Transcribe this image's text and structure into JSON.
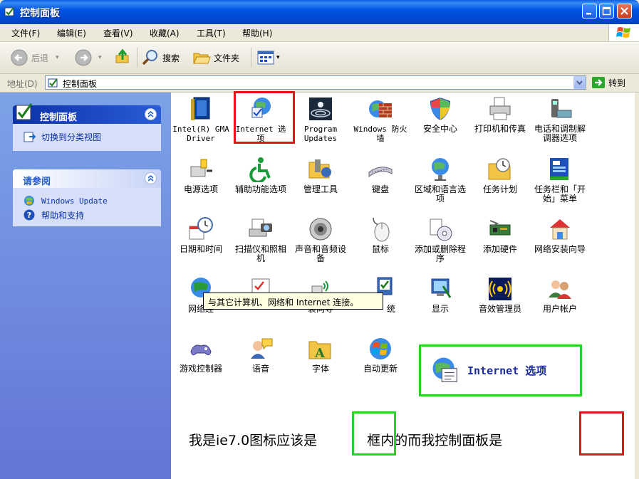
{
  "window": {
    "title": "控制面板"
  },
  "menu": [
    "文件(F)",
    "编辑(E)",
    "查看(V)",
    "收藏(A)",
    "工具(T)",
    "帮助(H)"
  ],
  "toolbar": {
    "back": "后退",
    "search": "搜索",
    "folders": "文件夹"
  },
  "address": {
    "label": "地址(D)",
    "value": "控制面板",
    "go": "转到"
  },
  "left_panel": {
    "main_title": "控制面板",
    "switch_view": "切换到分类视图",
    "see_also_title": "请参阅",
    "see_also": [
      "Windows Update",
      "帮助和支持"
    ]
  },
  "items": [
    {
      "label": "Intel(R) GMA Driver",
      "icon": "intel-gma-icon"
    },
    {
      "label": "Internet 选项",
      "icon": "internet-options-icon"
    },
    {
      "label": "Program Updates",
      "icon": "program-updates-icon"
    },
    {
      "label": "Windows 防火墙",
      "icon": "firewall-icon"
    },
    {
      "label": "安全中心",
      "icon": "security-shield-icon"
    },
    {
      "label": "打印机和传真",
      "icon": "printer-icon"
    },
    {
      "label": "电话和调制解调器选项",
      "icon": "phone-modem-icon"
    },
    {
      "label": "电源选项",
      "icon": "power-icon"
    },
    {
      "label": "辅助功能选项",
      "icon": "accessibility-icon"
    },
    {
      "label": "管理工具",
      "icon": "admin-tools-icon"
    },
    {
      "label": "键盘",
      "icon": "keyboard-icon"
    },
    {
      "label": "区域和语言选项",
      "icon": "globe-icon"
    },
    {
      "label": "任务计划",
      "icon": "scheduled-tasks-icon"
    },
    {
      "label": "任务栏和「开始」菜单",
      "icon": "taskbar-icon"
    },
    {
      "label": "日期和时间",
      "icon": "clock-icon"
    },
    {
      "label": "扫描仪和照相机",
      "icon": "scanner-icon"
    },
    {
      "label": "声音和音频设备",
      "icon": "speaker-icon"
    },
    {
      "label": "鼠标",
      "icon": "mouse-icon"
    },
    {
      "label": "添加或删除程序",
      "icon": "add-remove-icon"
    },
    {
      "label": "添加硬件",
      "icon": "add-hardware-icon"
    },
    {
      "label": "网络安装向导",
      "icon": "network-setup-icon"
    },
    {
      "label": "网络连",
      "icon": "network-connections-icon"
    },
    {
      "label": "装向导",
      "icon": "wireless-setup-icon"
    },
    {
      "label": "统",
      "icon": "system-icon"
    },
    {
      "label": "显示",
      "icon": "display-icon"
    },
    {
      "label": "音效管理员",
      "icon": "sound-manager-icon"
    },
    {
      "label": "用户帐户",
      "icon": "users-icon"
    },
    {
      "label": "游戏控制器",
      "icon": "gamepad-icon"
    },
    {
      "label": "语音",
      "icon": "speech-icon"
    },
    {
      "label": "字体",
      "icon": "fonts-icon"
    },
    {
      "label": "自动更新",
      "icon": "auto-update-icon"
    }
  ],
  "tooltip": "与其它计算机、网络和 Internet 连接。",
  "zoom_label": "Internet 选项",
  "annotation": {
    "part1": "我是ie7.0图标应该是",
    "part2": "框内的而我控制面板是"
  },
  "colors": {
    "highlight_red": "#e3151b",
    "highlight_green": "#2ad12a",
    "title_blue": "#0055e5"
  }
}
